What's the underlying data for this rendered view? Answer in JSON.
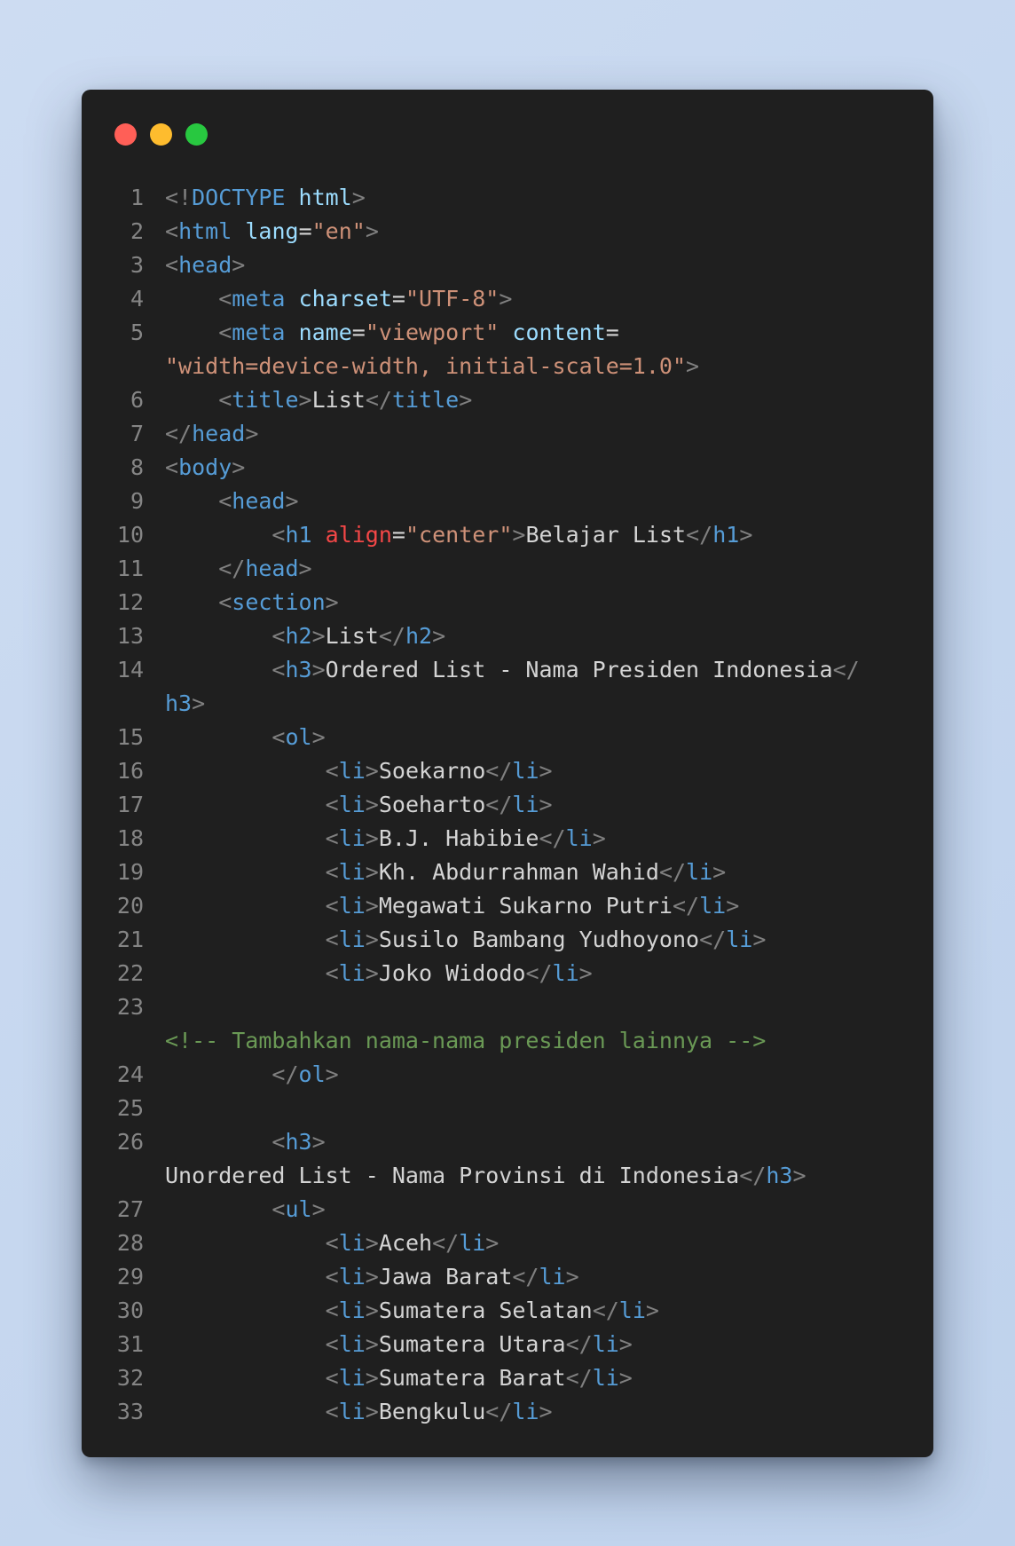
{
  "window": {
    "controls": [
      "close",
      "minimize",
      "maximize"
    ],
    "colors": {
      "close": "#ff5f57",
      "minimize": "#febc2e",
      "maximize": "#28c840"
    }
  },
  "theme": {
    "background": "#1f1f1f",
    "line_number": "#858585",
    "punctuation": "#808080",
    "tag": "#569cd6",
    "attribute": "#9cdcfe",
    "string": "#ce9178",
    "invalid_attribute": "#f44747",
    "comment": "#6a9955",
    "text": "#d4d4d4"
  },
  "code": {
    "language": "html",
    "rows": [
      {
        "ln": "1",
        "tokens": [
          [
            "punc",
            "<!"
          ],
          [
            "tag",
            "DOCTYPE"
          ],
          [
            "plain",
            " "
          ],
          [
            "attr",
            "html"
          ],
          [
            "punc",
            ">"
          ]
        ]
      },
      {
        "ln": "2",
        "tokens": [
          [
            "punc",
            "<"
          ],
          [
            "tag",
            "html"
          ],
          [
            "plain",
            " "
          ],
          [
            "attr",
            "lang"
          ],
          [
            "plain",
            "="
          ],
          [
            "str",
            "\"en\""
          ],
          [
            "punc",
            ">"
          ]
        ]
      },
      {
        "ln": "3",
        "tokens": [
          [
            "punc",
            "<"
          ],
          [
            "tag",
            "head"
          ],
          [
            "punc",
            ">"
          ]
        ]
      },
      {
        "ln": "4",
        "tokens": [
          [
            "plain",
            "    "
          ],
          [
            "punc",
            "<"
          ],
          [
            "tag",
            "meta"
          ],
          [
            "plain",
            " "
          ],
          [
            "attr",
            "charset"
          ],
          [
            "plain",
            "="
          ],
          [
            "str",
            "\"UTF-8\""
          ],
          [
            "punc",
            ">"
          ]
        ]
      },
      {
        "ln": "5",
        "tokens": [
          [
            "plain",
            "    "
          ],
          [
            "punc",
            "<"
          ],
          [
            "tag",
            "meta"
          ],
          [
            "plain",
            " "
          ],
          [
            "attr",
            "name"
          ],
          [
            "plain",
            "="
          ],
          [
            "str",
            "\"viewport\""
          ],
          [
            "plain",
            " "
          ],
          [
            "attr",
            "content"
          ],
          [
            "plain",
            "="
          ]
        ]
      },
      {
        "ln": "",
        "tokens": [
          [
            "str",
            "\"width=device-width, initial-scale=1.0\""
          ],
          [
            "punc",
            ">"
          ]
        ]
      },
      {
        "ln": "6",
        "tokens": [
          [
            "plain",
            "    "
          ],
          [
            "punc",
            "<"
          ],
          [
            "tag",
            "title"
          ],
          [
            "punc",
            ">"
          ],
          [
            "plain",
            "List"
          ],
          [
            "punc",
            "</"
          ],
          [
            "tag",
            "title"
          ],
          [
            "punc",
            ">"
          ]
        ]
      },
      {
        "ln": "7",
        "tokens": [
          [
            "punc",
            "</"
          ],
          [
            "tag",
            "head"
          ],
          [
            "punc",
            ">"
          ]
        ]
      },
      {
        "ln": "8",
        "tokens": [
          [
            "punc",
            "<"
          ],
          [
            "tag",
            "body"
          ],
          [
            "punc",
            ">"
          ]
        ]
      },
      {
        "ln": "9",
        "tokens": [
          [
            "plain",
            "    "
          ],
          [
            "punc",
            "<"
          ],
          [
            "tag",
            "head"
          ],
          [
            "punc",
            ">"
          ]
        ]
      },
      {
        "ln": "10",
        "tokens": [
          [
            "plain",
            "        "
          ],
          [
            "punc",
            "<"
          ],
          [
            "tag",
            "h1"
          ],
          [
            "plain",
            " "
          ],
          [
            "bad",
            "align"
          ],
          [
            "plain",
            "="
          ],
          [
            "str",
            "\"center\""
          ],
          [
            "punc",
            ">"
          ],
          [
            "plain",
            "Belajar List"
          ],
          [
            "punc",
            "</"
          ],
          [
            "tag",
            "h1"
          ],
          [
            "punc",
            ">"
          ]
        ]
      },
      {
        "ln": "11",
        "tokens": [
          [
            "plain",
            "    "
          ],
          [
            "punc",
            "</"
          ],
          [
            "tag",
            "head"
          ],
          [
            "punc",
            ">"
          ]
        ]
      },
      {
        "ln": "12",
        "tokens": [
          [
            "plain",
            "    "
          ],
          [
            "punc",
            "<"
          ],
          [
            "tag",
            "section"
          ],
          [
            "punc",
            ">"
          ]
        ]
      },
      {
        "ln": "13",
        "tokens": [
          [
            "plain",
            "        "
          ],
          [
            "punc",
            "<"
          ],
          [
            "tag",
            "h2"
          ],
          [
            "punc",
            ">"
          ],
          [
            "plain",
            "List"
          ],
          [
            "punc",
            "</"
          ],
          [
            "tag",
            "h2"
          ],
          [
            "punc",
            ">"
          ]
        ]
      },
      {
        "ln": "14",
        "tokens": [
          [
            "plain",
            "        "
          ],
          [
            "punc",
            "<"
          ],
          [
            "tag",
            "h3"
          ],
          [
            "punc",
            ">"
          ],
          [
            "plain",
            "Ordered List - Nama Presiden Indonesia"
          ],
          [
            "punc",
            "</"
          ]
        ]
      },
      {
        "ln": "",
        "tokens": [
          [
            "tag",
            "h3"
          ],
          [
            "punc",
            ">"
          ]
        ]
      },
      {
        "ln": "15",
        "tokens": [
          [
            "plain",
            "        "
          ],
          [
            "punc",
            "<"
          ],
          [
            "tag",
            "ol"
          ],
          [
            "punc",
            ">"
          ]
        ]
      },
      {
        "ln": "16",
        "tokens": [
          [
            "plain",
            "            "
          ],
          [
            "punc",
            "<"
          ],
          [
            "tag",
            "li"
          ],
          [
            "punc",
            ">"
          ],
          [
            "plain",
            "Soekarno"
          ],
          [
            "punc",
            "</"
          ],
          [
            "tag",
            "li"
          ],
          [
            "punc",
            ">"
          ]
        ]
      },
      {
        "ln": "17",
        "tokens": [
          [
            "plain",
            "            "
          ],
          [
            "punc",
            "<"
          ],
          [
            "tag",
            "li"
          ],
          [
            "punc",
            ">"
          ],
          [
            "plain",
            "Soeharto"
          ],
          [
            "punc",
            "</"
          ],
          [
            "tag",
            "li"
          ],
          [
            "punc",
            ">"
          ]
        ]
      },
      {
        "ln": "18",
        "tokens": [
          [
            "plain",
            "            "
          ],
          [
            "punc",
            "<"
          ],
          [
            "tag",
            "li"
          ],
          [
            "punc",
            ">"
          ],
          [
            "plain",
            "B.J. Habibie"
          ],
          [
            "punc",
            "</"
          ],
          [
            "tag",
            "li"
          ],
          [
            "punc",
            ">"
          ]
        ]
      },
      {
        "ln": "19",
        "tokens": [
          [
            "plain",
            "            "
          ],
          [
            "punc",
            "<"
          ],
          [
            "tag",
            "li"
          ],
          [
            "punc",
            ">"
          ],
          [
            "plain",
            "Kh. Abdurrahman Wahid"
          ],
          [
            "punc",
            "</"
          ],
          [
            "tag",
            "li"
          ],
          [
            "punc",
            ">"
          ]
        ]
      },
      {
        "ln": "20",
        "tokens": [
          [
            "plain",
            "            "
          ],
          [
            "punc",
            "<"
          ],
          [
            "tag",
            "li"
          ],
          [
            "punc",
            ">"
          ],
          [
            "plain",
            "Megawati Sukarno Putri"
          ],
          [
            "punc",
            "</"
          ],
          [
            "tag",
            "li"
          ],
          [
            "punc",
            ">"
          ]
        ]
      },
      {
        "ln": "21",
        "tokens": [
          [
            "plain",
            "            "
          ],
          [
            "punc",
            "<"
          ],
          [
            "tag",
            "li"
          ],
          [
            "punc",
            ">"
          ],
          [
            "plain",
            "Susilo Bambang Yudhoyono"
          ],
          [
            "punc",
            "</"
          ],
          [
            "tag",
            "li"
          ],
          [
            "punc",
            ">"
          ]
        ]
      },
      {
        "ln": "22",
        "tokens": [
          [
            "plain",
            "            "
          ],
          [
            "punc",
            "<"
          ],
          [
            "tag",
            "li"
          ],
          [
            "punc",
            ">"
          ],
          [
            "plain",
            "Joko Widodo"
          ],
          [
            "punc",
            "</"
          ],
          [
            "tag",
            "li"
          ],
          [
            "punc",
            ">"
          ]
        ]
      },
      {
        "ln": "23",
        "tokens": []
      },
      {
        "ln": "",
        "tokens": [
          [
            "com",
            "<!-- Tambahkan nama-nama presiden lainnya -->"
          ]
        ]
      },
      {
        "ln": "24",
        "tokens": [
          [
            "plain",
            "        "
          ],
          [
            "punc",
            "</"
          ],
          [
            "tag",
            "ol"
          ],
          [
            "punc",
            ">"
          ]
        ]
      },
      {
        "ln": "25",
        "tokens": []
      },
      {
        "ln": "26",
        "tokens": [
          [
            "plain",
            "        "
          ],
          [
            "punc",
            "<"
          ],
          [
            "tag",
            "h3"
          ],
          [
            "punc",
            ">"
          ]
        ]
      },
      {
        "ln": "",
        "tokens": [
          [
            "plain",
            "Unordered List - Nama Provinsi di Indonesia"
          ],
          [
            "punc",
            "</"
          ],
          [
            "tag",
            "h3"
          ],
          [
            "punc",
            ">"
          ]
        ]
      },
      {
        "ln": "27",
        "tokens": [
          [
            "plain",
            "        "
          ],
          [
            "punc",
            "<"
          ],
          [
            "tag",
            "ul"
          ],
          [
            "punc",
            ">"
          ]
        ]
      },
      {
        "ln": "28",
        "tokens": [
          [
            "plain",
            "            "
          ],
          [
            "punc",
            "<"
          ],
          [
            "tag",
            "li"
          ],
          [
            "punc",
            ">"
          ],
          [
            "plain",
            "Aceh"
          ],
          [
            "punc",
            "</"
          ],
          [
            "tag",
            "li"
          ],
          [
            "punc",
            ">"
          ]
        ]
      },
      {
        "ln": "29",
        "tokens": [
          [
            "plain",
            "            "
          ],
          [
            "punc",
            "<"
          ],
          [
            "tag",
            "li"
          ],
          [
            "punc",
            ">"
          ],
          [
            "plain",
            "Jawa Barat"
          ],
          [
            "punc",
            "</"
          ],
          [
            "tag",
            "li"
          ],
          [
            "punc",
            ">"
          ]
        ]
      },
      {
        "ln": "30",
        "tokens": [
          [
            "plain",
            "            "
          ],
          [
            "punc",
            "<"
          ],
          [
            "tag",
            "li"
          ],
          [
            "punc",
            ">"
          ],
          [
            "plain",
            "Sumatera Selatan"
          ],
          [
            "punc",
            "</"
          ],
          [
            "tag",
            "li"
          ],
          [
            "punc",
            ">"
          ]
        ]
      },
      {
        "ln": "31",
        "tokens": [
          [
            "plain",
            "            "
          ],
          [
            "punc",
            "<"
          ],
          [
            "tag",
            "li"
          ],
          [
            "punc",
            ">"
          ],
          [
            "plain",
            "Sumatera Utara"
          ],
          [
            "punc",
            "</"
          ],
          [
            "tag",
            "li"
          ],
          [
            "punc",
            ">"
          ]
        ]
      },
      {
        "ln": "32",
        "tokens": [
          [
            "plain",
            "            "
          ],
          [
            "punc",
            "<"
          ],
          [
            "tag",
            "li"
          ],
          [
            "punc",
            ">"
          ],
          [
            "plain",
            "Sumatera Barat"
          ],
          [
            "punc",
            "</"
          ],
          [
            "tag",
            "li"
          ],
          [
            "punc",
            ">"
          ]
        ]
      },
      {
        "ln": "33",
        "tokens": [
          [
            "plain",
            "            "
          ],
          [
            "punc",
            "<"
          ],
          [
            "tag",
            "li"
          ],
          [
            "punc",
            ">"
          ],
          [
            "plain",
            "Bengkulu"
          ],
          [
            "punc",
            "</"
          ],
          [
            "tag",
            "li"
          ],
          [
            "punc",
            ">"
          ]
        ]
      }
    ]
  }
}
